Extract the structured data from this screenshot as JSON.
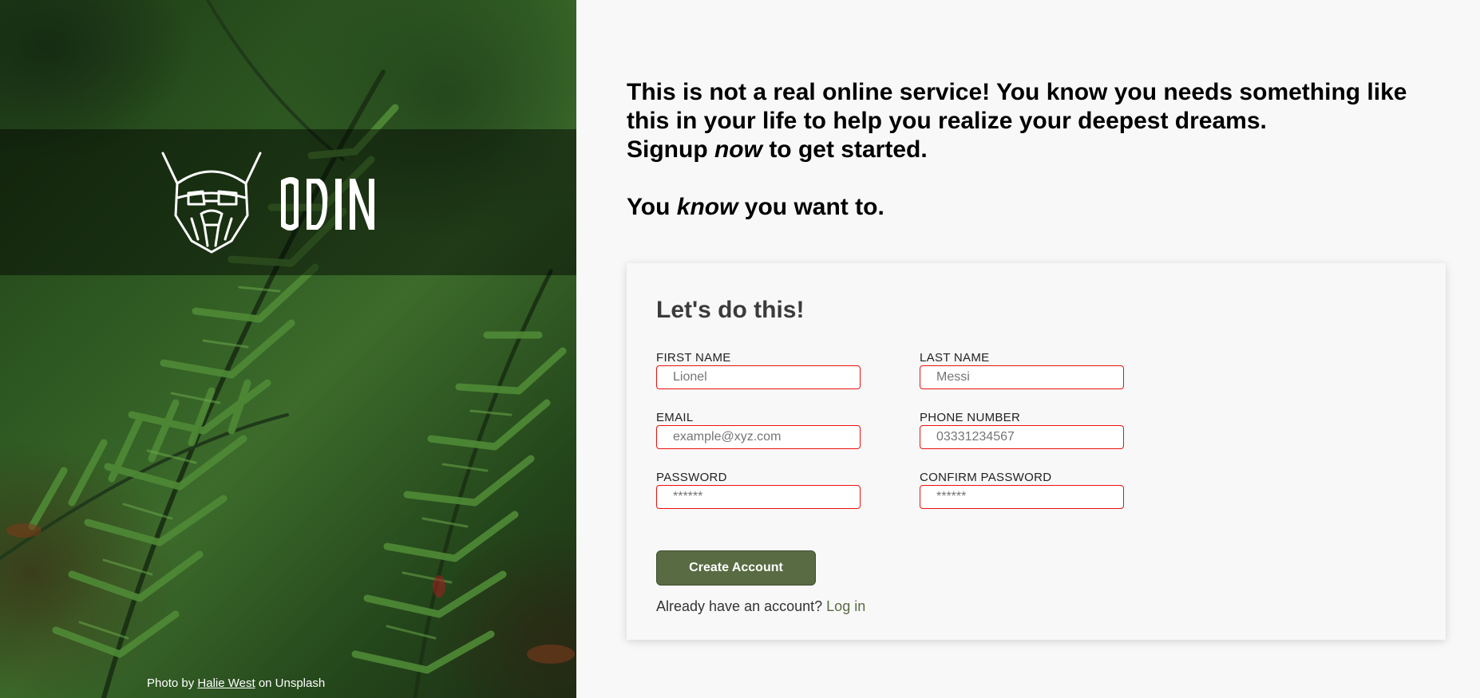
{
  "hero": {
    "brand_name": "ODIN",
    "credit_prefix": "Photo by",
    "credit_author": "Halie West",
    "credit_suffix": "on Unsplash"
  },
  "intro": {
    "line1": "This is not a real online service! You know you needs something like this in your life to help you realize your deepest dreams.",
    "line2_before": "Signup ",
    "line2_em": "now",
    "line2_after": " to get started.",
    "line3_before": "You ",
    "line3_em": "know",
    "line3_after": " you want to."
  },
  "form": {
    "heading": "Let's do this!",
    "fields": [
      {
        "label": "FIRST NAME",
        "placeholder": "Lionel",
        "value": ""
      },
      {
        "label": "LAST NAME",
        "placeholder": "Messi",
        "value": ""
      },
      {
        "label": "EMAIL",
        "placeholder": "example@xyz.com",
        "value": ""
      },
      {
        "label": "PHONE NUMBER",
        "placeholder": "03331234567",
        "value": ""
      },
      {
        "label": "PASSWORD",
        "placeholder": "******",
        "value": ""
      },
      {
        "label": "CONFIRM PASSWORD",
        "placeholder": "******",
        "value": ""
      }
    ],
    "submit_label": "Create Account",
    "login_prompt": "Already have an account?",
    "login_link": "Log in"
  },
  "colors": {
    "accent": "#596b43",
    "invalid_border": "#ee1111",
    "background": "#f8f8f8"
  },
  "icons": {
    "logo": "viking-helmet-icon"
  }
}
